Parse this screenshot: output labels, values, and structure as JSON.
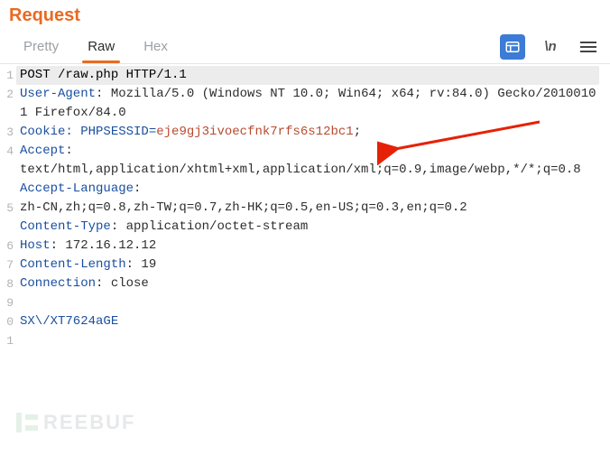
{
  "title": "Request",
  "tabs": {
    "pretty": "Pretty",
    "raw": "Raw",
    "hex": "Hex"
  },
  "tool_newline": "\\n",
  "gutter": [
    "1",
    "2",
    "3",
    "4",
    "5",
    "6",
    "7",
    "8",
    "9",
    "0",
    "1"
  ],
  "req": {
    "start": "POST /raw.php HTTP/1.1",
    "ua_k": "User-Agent",
    "ua_v": ": Mozilla/5.0 (Windows NT 10.0; Win64; x64; rv:84.0) Gecko/20100101 Firefox/84.0",
    "cookie_k": "Cookie",
    "cookie_mid": ": PHPSESSID=",
    "cookie_sess": "eje9gj3ivoecfnk7rfs6s12bc1",
    "cookie_end": ";",
    "accept_k": "Accept",
    "accept_v": ":\ntext/html,application/xhtml+xml,application/xml;q=0.9,image/webp,*/*;q=0.8",
    "al_k": "Accept-Language",
    "al_v": ":\nzh-CN,zh;q=0.8,zh-TW;q=0.7,zh-HK;q=0.5,en-US;q=0.3,en;q=0.2",
    "ct_k": "Content-Type",
    "ct_v": ": application/octet-stream",
    "host_k": "Host",
    "host_v": ": 172.16.12.12",
    "cl_k": "Content-Length",
    "cl_v": ": 19",
    "conn_k": "Connection",
    "conn_v": ": close",
    "blank": " ",
    "body": "SX\\/XT7624aGE"
  },
  "watermark": "REEBUF"
}
